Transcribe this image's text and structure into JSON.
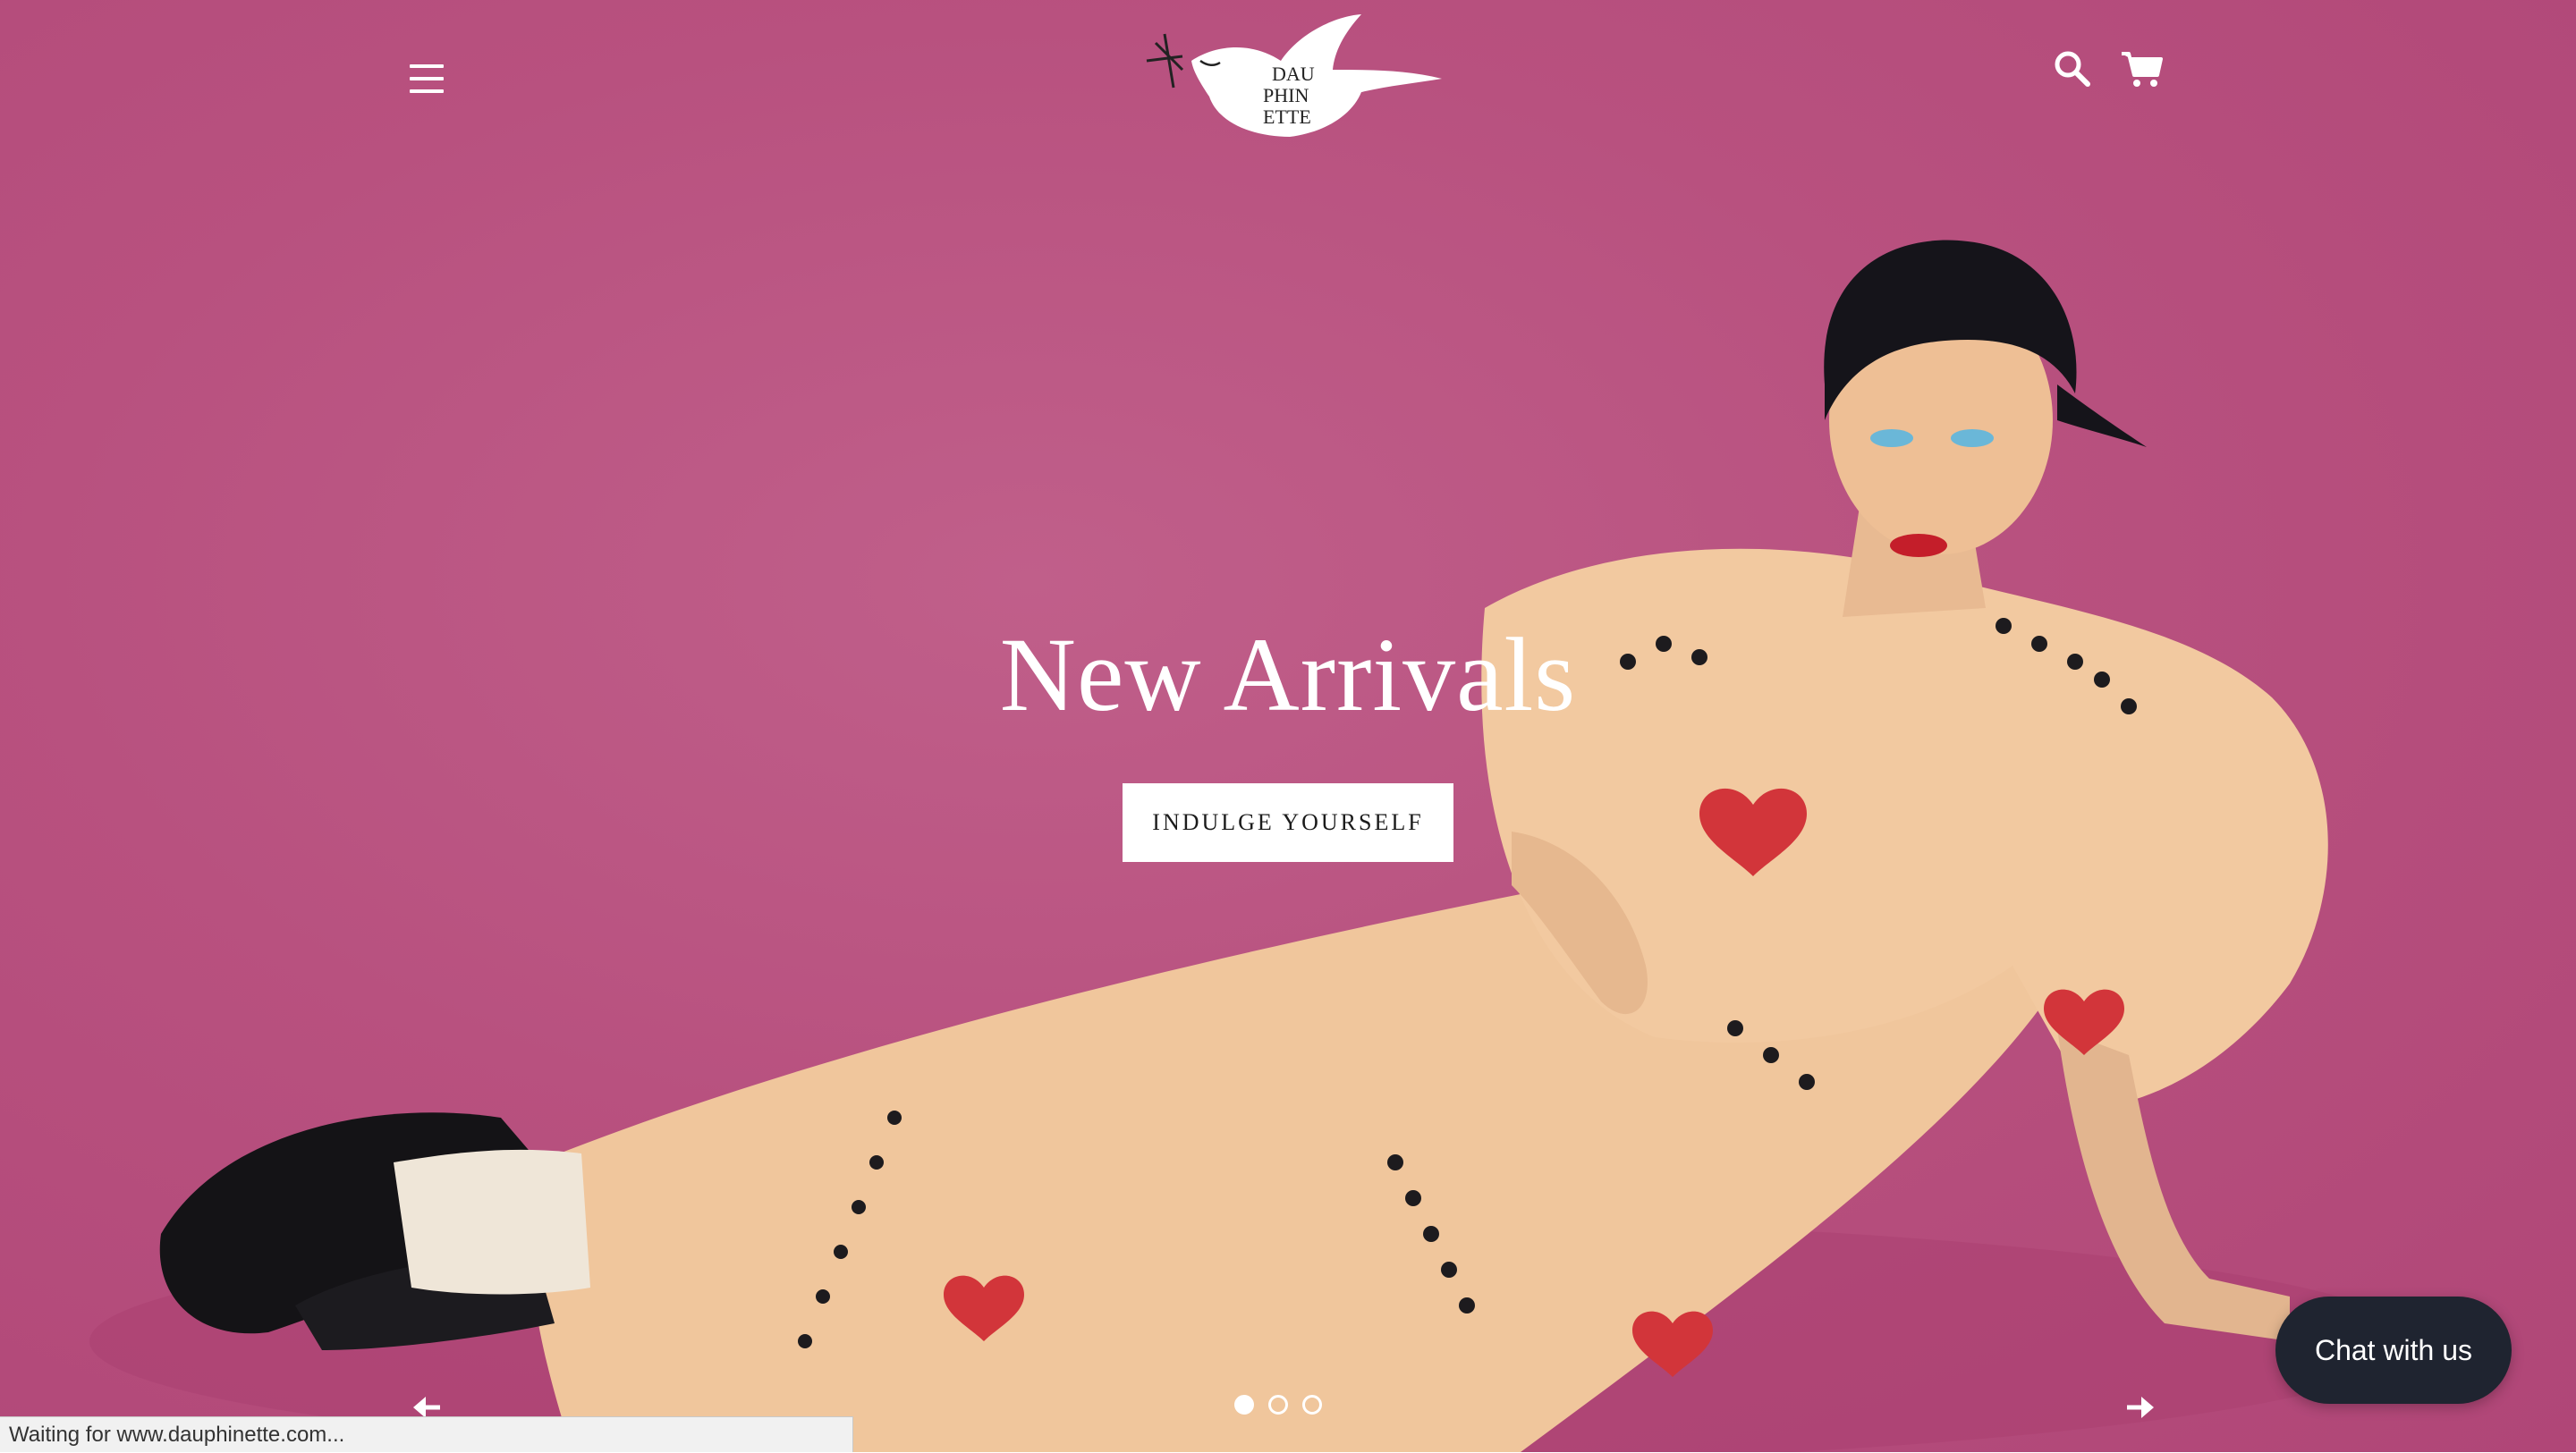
{
  "header": {
    "menu_icon": "hamburger-menu-icon",
    "logo_text": [
      "DAU",
      "PHIN",
      "ETTE"
    ],
    "search_icon": "search-icon",
    "cart_icon": "cart-icon"
  },
  "hero": {
    "headline": "New Arrivals",
    "cta_label": "INDULGE YOURSELF",
    "prev_icon": "arrow-left-icon",
    "next_icon": "arrow-right-icon",
    "slides": [
      {
        "active": true
      },
      {
        "active": false
      },
      {
        "active": false
      }
    ]
  },
  "chat": {
    "label": "Chat with us"
  },
  "status_bar": {
    "text": "Waiting for www.dauphinette.com..."
  },
  "colors": {
    "background": "#b8517f",
    "text": "#ffffff",
    "chat_bg": "#1f2430"
  }
}
